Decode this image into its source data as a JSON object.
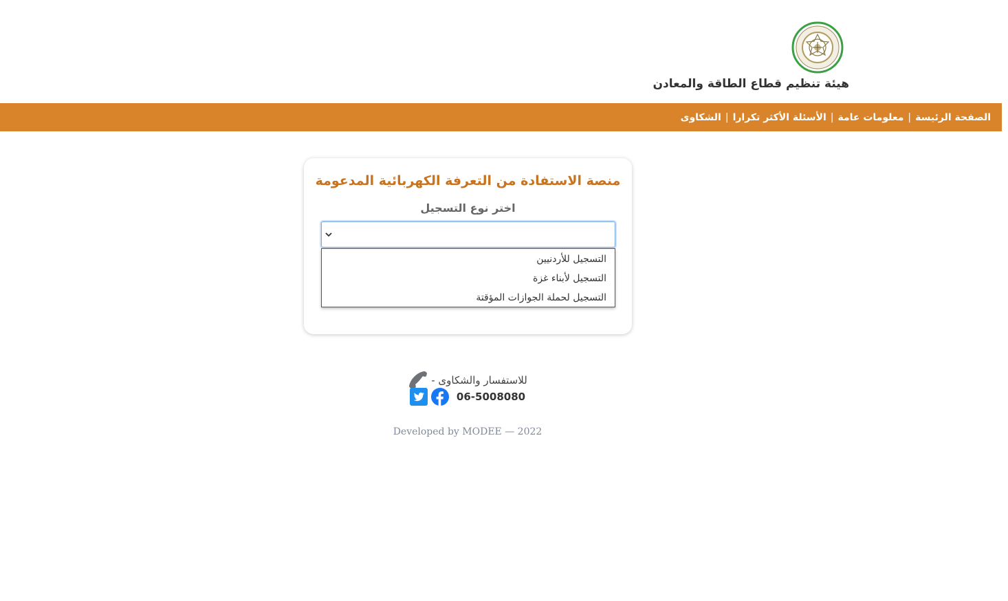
{
  "header": {
    "org_name": "هيئة تنظيم قطاع الطاقة والمعادن",
    "logo_icon": "regulatory-commission-seal-icon"
  },
  "nav": {
    "items": [
      {
        "label": "الصفحة الرئيسة"
      },
      {
        "label": "معلومات عامة"
      },
      {
        "label": "الأسئلة الأكثر تكرارا"
      },
      {
        "label": "الشكاوى"
      }
    ],
    "separator": "|",
    "background_color": "#d9832a"
  },
  "card": {
    "title": "منصة الاستفادة من التعرفة الكهربائية المدعومة",
    "select_label": "اختر نوع التسجيل",
    "select_value": "",
    "options": [
      "التسجيل للأردنيين",
      "التسجيل لأبناء غزة",
      "التسجيل لحملة الجوازات المؤقتة"
    ],
    "title_color": "#c7731f"
  },
  "footer": {
    "contact_text": "للاستفسار والشكاوى -",
    "phone_icon": "phone-icon",
    "phone_number": "06-5008080",
    "social": [
      {
        "icon": "facebook-icon"
      },
      {
        "icon": "twitter-icon"
      }
    ],
    "credit": "Developed by MODEE — 2022"
  }
}
